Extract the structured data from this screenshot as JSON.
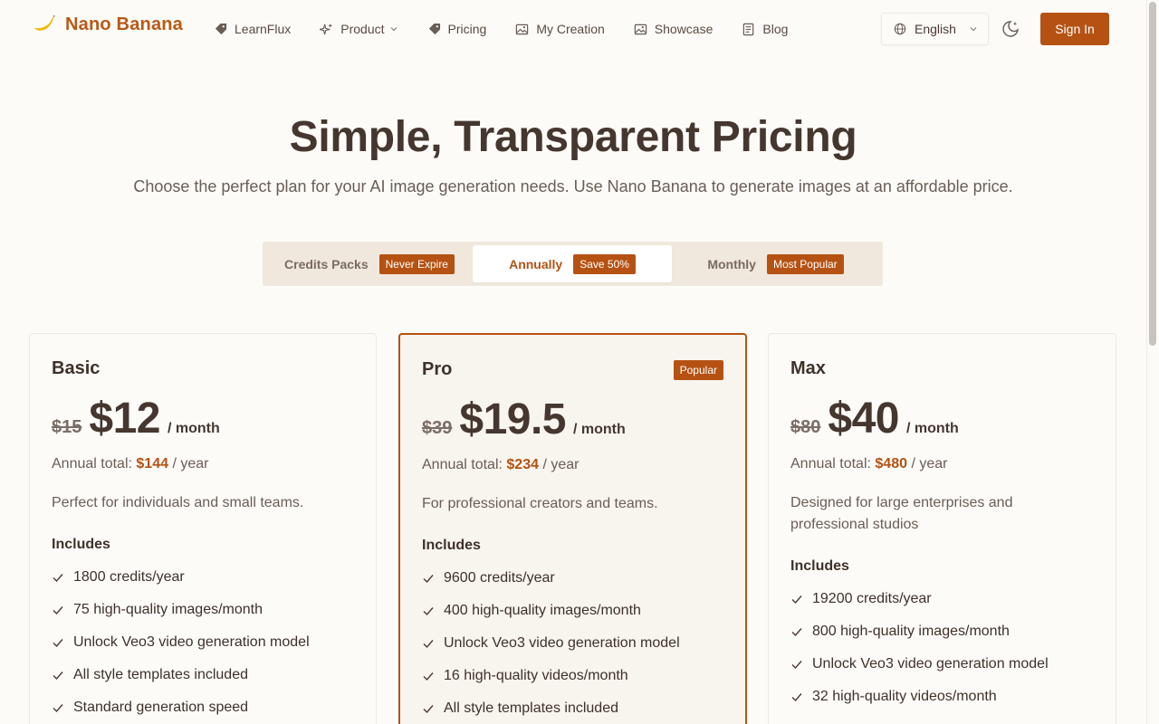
{
  "brand": {
    "name": "Nano Banana"
  },
  "nav": [
    {
      "label": "LearnFlux",
      "icon": "tag-icon"
    },
    {
      "label": "Product",
      "icon": "sparkle-icon",
      "dropdown": true
    },
    {
      "label": "Pricing",
      "icon": "tag-icon"
    },
    {
      "label": "My Creation",
      "icon": "image-icon"
    },
    {
      "label": "Showcase",
      "icon": "image-icon"
    },
    {
      "label": "Blog",
      "icon": "document-icon"
    }
  ],
  "language": {
    "selected": "English"
  },
  "signin_label": "Sign In",
  "hero": {
    "title": "Simple, Transparent Pricing",
    "subtitle": "Choose the perfect plan for your AI image generation needs. Use Nano Banana to generate images at an affordable price."
  },
  "tabs": [
    {
      "label": "Credits Packs",
      "badge": "Never Expire",
      "active": false
    },
    {
      "label": "Annually",
      "badge": "Save 50%",
      "active": true
    },
    {
      "label": "Monthly",
      "badge": "Most Popular",
      "active": false
    }
  ],
  "plans": [
    {
      "name": "Basic",
      "old_price": "$15",
      "price": "$12",
      "period": "/ month",
      "annual_prefix": "Annual total:",
      "annual_amount": "$144",
      "annual_suffix": "/ year",
      "description": "Perfect for individuals and small teams.",
      "includes_label": "Includes",
      "features": [
        "1800 credits/year",
        "75 high-quality images/month",
        "Unlock Veo3 video generation model",
        "All style templates included",
        "Standard generation speed"
      ]
    },
    {
      "name": "Pro",
      "badge": "Popular",
      "old_price": "$39",
      "price": "$19.5",
      "period": "/ month",
      "annual_prefix": "Annual total:",
      "annual_amount": "$234",
      "annual_suffix": "/ year",
      "description": "For professional creators and teams.",
      "includes_label": "Includes",
      "features": [
        "9600 credits/year",
        "400 high-quality images/month",
        "Unlock Veo3 video generation model",
        "16 high-quality videos/month",
        "All style templates included"
      ]
    },
    {
      "name": "Max",
      "old_price": "$80",
      "price": "$40",
      "period": "/ month",
      "annual_prefix": "Annual total:",
      "annual_amount": "$480",
      "annual_suffix": "/ year",
      "description": "Designed for large enterprises and professional studios",
      "includes_label": "Includes",
      "features": [
        "19200 credits/year",
        "800 high-quality images/month",
        "Unlock Veo3 video generation model",
        "32 high-quality videos/month"
      ]
    }
  ],
  "colors": {
    "accent": "#b55213",
    "brand_text": "#b85a16",
    "background": "#fcfbf8",
    "tab_bg": "#f0e8dc"
  }
}
